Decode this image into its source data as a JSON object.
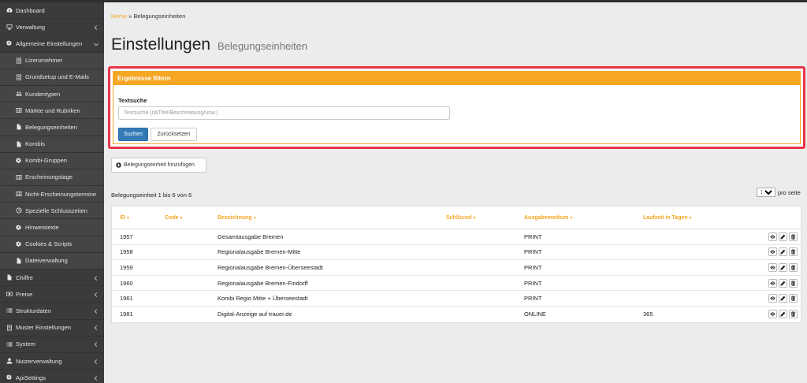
{
  "sidebar": {
    "items": [
      {
        "label": "Dashboard",
        "icon": "dashboard-icon",
        "chevron": false,
        "sub": false
      },
      {
        "label": "Verwaltung",
        "icon": "monitor-icon",
        "chevron": "left",
        "sub": false
      },
      {
        "label": "Allgemeine Einstellungen",
        "icon": "gears-icon",
        "chevron": "down",
        "sub": false
      },
      {
        "label": "Lizenznehmer",
        "icon": "id-card-icon",
        "chevron": false,
        "sub": true
      },
      {
        "label": "Grundsetup und E-Mails",
        "icon": "id-card-icon",
        "chevron": false,
        "sub": true
      },
      {
        "label": "Kundentypen",
        "icon": "users-icon",
        "chevron": false,
        "sub": true
      },
      {
        "label": "Märkte und Rubriken",
        "icon": "list-alt-icon",
        "chevron": false,
        "sub": true
      },
      {
        "label": "Belegungseinheiten",
        "icon": "file-icon",
        "chevron": false,
        "sub": true
      },
      {
        "label": "Kombis",
        "icon": "file-icon",
        "chevron": false,
        "sub": true
      },
      {
        "label": "Kombi-Gruppen",
        "icon": "gears-icon",
        "chevron": false,
        "sub": true
      },
      {
        "label": "Erscheinungstage",
        "icon": "list-alt-icon",
        "chevron": false,
        "sub": true
      },
      {
        "label": "Nicht-Erscheinungstermine",
        "icon": "list-alt-icon",
        "chevron": false,
        "sub": true
      },
      {
        "label": "Spezielle Schlusszeiten",
        "icon": "clock-icon",
        "chevron": false,
        "sub": true
      },
      {
        "label": "Hinweistexte",
        "icon": "gears-icon",
        "chevron": false,
        "sub": true
      },
      {
        "label": "Cookies & Scripts",
        "icon": "gears-icon",
        "chevron": false,
        "sub": true
      },
      {
        "label": "Dateiverwaltung",
        "icon": "file-icon",
        "chevron": false,
        "sub": true
      },
      {
        "label": "Chiffre",
        "icon": "file-icon",
        "chevron": "left",
        "sub": false
      },
      {
        "label": "Preise",
        "icon": "money-icon",
        "chevron": "left",
        "sub": false
      },
      {
        "label": "Strukturdaten",
        "icon": "list-icon",
        "chevron": "left",
        "sub": false
      },
      {
        "label": "Muster Einstellungen",
        "icon": "id-card-icon",
        "chevron": "left",
        "sub": false
      },
      {
        "label": "System",
        "icon": "list-icon",
        "chevron": "left",
        "sub": false
      },
      {
        "label": "Nutzerverwaltung",
        "icon": "user-icon",
        "chevron": "left",
        "sub": false
      },
      {
        "label": "ApiSettings",
        "icon": "gears-icon",
        "chevron": "left",
        "sub": false
      }
    ]
  },
  "breadcrumb": {
    "home": "Home",
    "separator": " » ",
    "current": "Belegungseinheiten"
  },
  "page": {
    "title": "Einstellungen",
    "subtitle": "Belegungseinheiten"
  },
  "filter": {
    "heading": "Ergebnisse filtern",
    "label": "Textsuche",
    "value": "",
    "placeholder": "Textsuche (Id/Titel/Beschreibung/usw.)",
    "search_label": "Suchen",
    "reset_label": "Zurücksetzen"
  },
  "add_button": {
    "label": "Belegungseinheit hinzufügen"
  },
  "pagination": {
    "info": "Belegungseinheit 1 bis 6 von 6",
    "page_size": "10",
    "per_page_label": "pro seite"
  },
  "table": {
    "columns": [
      "ID",
      "Code",
      "Bezeichnung",
      "Schlüssel",
      "Ausgabemedium",
      "Laufzeit in Tagen"
    ],
    "rows": [
      [
        "1957",
        "",
        "Gesamtausgabe Bremen",
        "",
        "PRINT",
        ""
      ],
      [
        "1958",
        "",
        "Regionalausgabe Bremen-Mitte",
        "",
        "PRINT",
        ""
      ],
      [
        "1959",
        "",
        "Regionalausgabe Bremen-Überseestadt",
        "",
        "PRINT",
        ""
      ],
      [
        "1960",
        "",
        "Regionalausgabe Bremen-Findorff",
        "",
        "PRINT",
        ""
      ],
      [
        "1961",
        "",
        "Kombi Regio Mitte + Überseestadt",
        "",
        "PRINT",
        ""
      ],
      [
        "1981",
        "",
        "Digital-Anzeige auf trauer.de",
        "",
        "ONLINE",
        "365"
      ]
    ]
  },
  "colors": {
    "accent": "#f5a623",
    "primary": "#337ab7",
    "highlight": "#e8344a",
    "sidebar": "#3b3b3b"
  }
}
